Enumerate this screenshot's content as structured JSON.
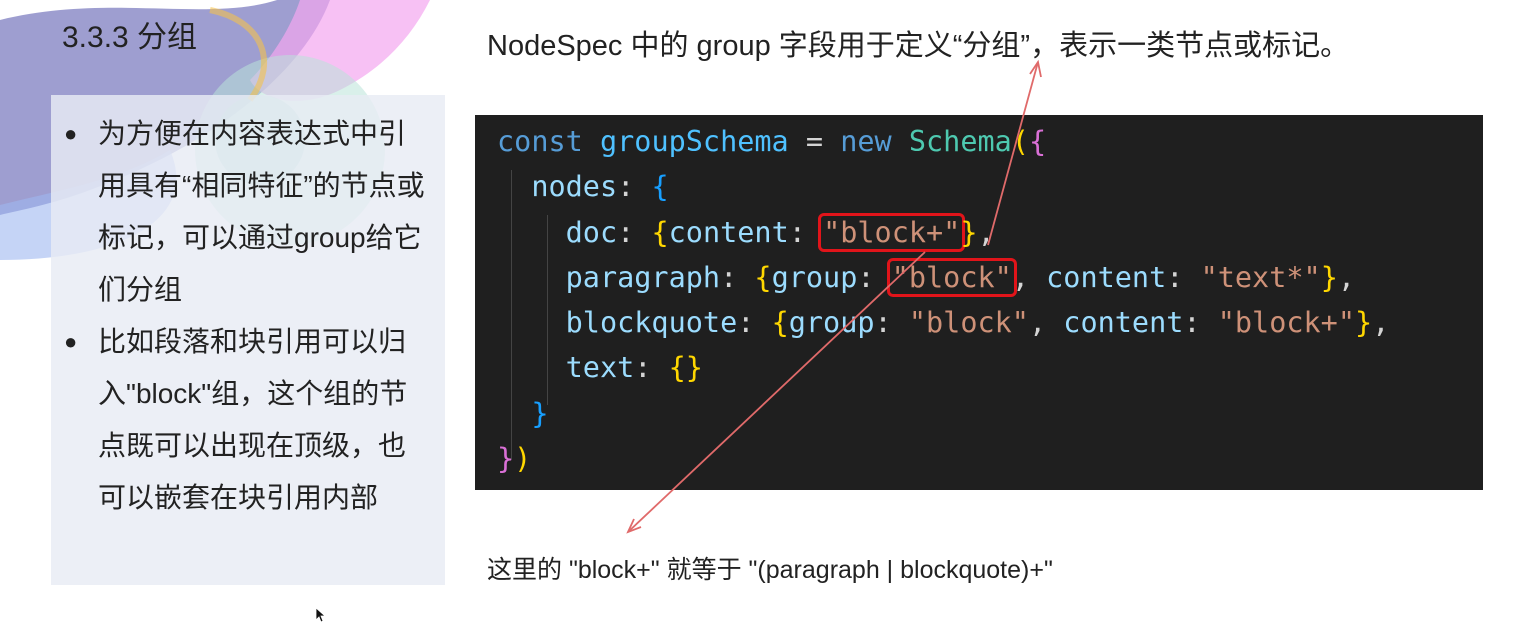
{
  "slide": {
    "title": "3.3.3 分组",
    "bullets": [
      "为方便在内容表达式中引用具有“相同特征”的节点或标记，可以通过group给它们分组",
      "比如段落和块引用可以归入\"block\"组，这个组的节点既可以出现在顶级，也可以嵌套在块引用内部"
    ],
    "description": "NodeSpec 中的 group 字段用于定义“分组”，表示一类节点或标记。",
    "note": "这里的 \"block+\" 就等于 \"(paragraph | blockquote)+\""
  },
  "code": {
    "line1": {
      "kw": "const",
      "name": "groupSchema",
      "op": " = ",
      "new": "new",
      "cls": "Schema",
      "paren": "(",
      "brace": "{"
    },
    "line2": {
      "key": "nodes",
      "colon": ": ",
      "brace": "{"
    },
    "line3": {
      "key": "doc",
      "colon": ": ",
      "open": "{",
      "inner": "content",
      "colon2": ": ",
      "str": "\"block+\"",
      "close": "}",
      "comma": ","
    },
    "line4": {
      "key": "paragraph",
      "colon": ": ",
      "open": "{",
      "inner1": "group",
      "colon2": ": ",
      "str1": "\"block\"",
      "sep": ", ",
      "inner2": "content",
      "colon3": ": ",
      "str2": "\"text*\"",
      "close": "}",
      "comma": ","
    },
    "line5": {
      "key": "blockquote",
      "colon": ": ",
      "open": "{",
      "inner1": "group",
      "colon2": ": ",
      "str1": "\"block\"",
      "sep": ", ",
      "inner2": "content",
      "colon3": ": ",
      "str2": "\"block+\"",
      "close": "}",
      "comma": ","
    },
    "line6": {
      "key": "text",
      "colon": ": ",
      "braces": "{}"
    },
    "line7": {
      "brace": "}"
    },
    "line8": {
      "brace": "}",
      "paren": ")"
    }
  },
  "colors": {
    "code_bg": "#1f1f1f",
    "highlight": "#e1141a",
    "arrow": "#e06a6a",
    "panel_bg": "#e8ecf4"
  }
}
